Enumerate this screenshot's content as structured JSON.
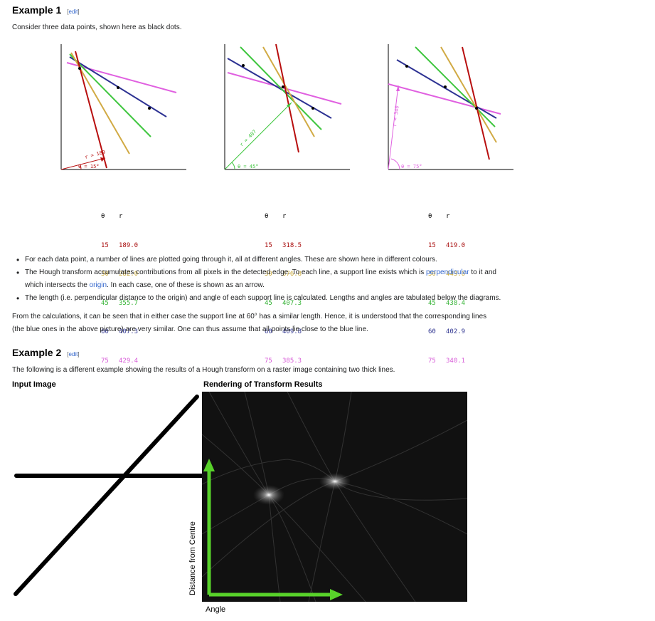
{
  "example1": {
    "heading": "Example 1",
    "edit_open": "[",
    "edit_label": "edit",
    "edit_close": "]",
    "intro": "Consider three data points, shown here as black dots.",
    "figures": [
      {
        "r_label": "r = 189",
        "theta_label": "θ = 15°"
      },
      {
        "r_label": "r = 407",
        "theta_label": "θ = 45°"
      },
      {
        "r_label": "r = 340",
        "theta_label": "θ = 75°"
      }
    ],
    "tables": [
      {
        "header_theta": "θ",
        "header_r": "r",
        "rows": [
          {
            "theta": "15",
            "r": "189.0"
          },
          {
            "theta": "30",
            "r": "282.0"
          },
          {
            "theta": "45",
            "r": "355.7"
          },
          {
            "theta": "60",
            "r": "407.3"
          },
          {
            "theta": "75",
            "r": "429.4"
          }
        ]
      },
      {
        "header_theta": "θ",
        "header_r": "r",
        "rows": [
          {
            "theta": "15",
            "r": "318.5"
          },
          {
            "theta": "30",
            "r": "376.8"
          },
          {
            "theta": "45",
            "r": "407.3"
          },
          {
            "theta": "60",
            "r": "409.8"
          },
          {
            "theta": "75",
            "r": "385.3"
          }
        ]
      },
      {
        "header_theta": "θ",
        "header_r": "r",
        "rows": [
          {
            "theta": "15",
            "r": "419.0"
          },
          {
            "theta": "30",
            "r": "443.6"
          },
          {
            "theta": "45",
            "r": "438.4"
          },
          {
            "theta": "60",
            "r": "402.9"
          },
          {
            "theta": "75",
            "r": "340.1"
          }
        ]
      }
    ],
    "row_colors": [
      "#a80d0d",
      "#c9a93a",
      "#34b234",
      "#2f3590",
      "#d75ad7"
    ],
    "bullets": {
      "b1": "For each data point, a number of lines are plotted going through it, all at different angles. These are shown here in different colours.",
      "b2_pre": "The Hough transform accumulates contributions from all pixels in the detected edge. To each line, a support line exists which is ",
      "b2_link": "perpendicular",
      "b2_post": " to it and",
      "b2_line2_pre": "which intersects the ",
      "b2_link2": "origin",
      "b2_line2_post": ". In each case, one of these is shown as an arrow.",
      "b3": "The length (i.e. perpendicular distance to the origin) and angle of each support line is calculated. Lengths and angles are tabulated below the diagrams."
    },
    "conclusion_line1": "From the calculations, it can be seen that in either case the support line at 60° has a similar length. Hence, it is understood that the corresponding lines",
    "conclusion_line2": "(the blue ones in the above picture) are very similar. One can thus assume that all points lie close to the blue line."
  },
  "example2": {
    "heading": "Example 2",
    "edit_open": "[",
    "edit_label": "edit",
    "edit_close": "]",
    "intro": "The following is a different example showing the results of a Hough transform on a raster image containing two thick lines.",
    "input_caption": "Input Image",
    "result_caption": "Rendering of Transform Results",
    "y_axis_label": "Distance from Centre",
    "x_axis_label": "Angle"
  },
  "colors": {
    "red": "#b80f0f",
    "gold": "#d1aa44",
    "green": "#3fc63f",
    "blue": "#2c3192",
    "magenta": "#e060e0",
    "arrow_green": "#58d22a",
    "link": "#3366cc"
  }
}
